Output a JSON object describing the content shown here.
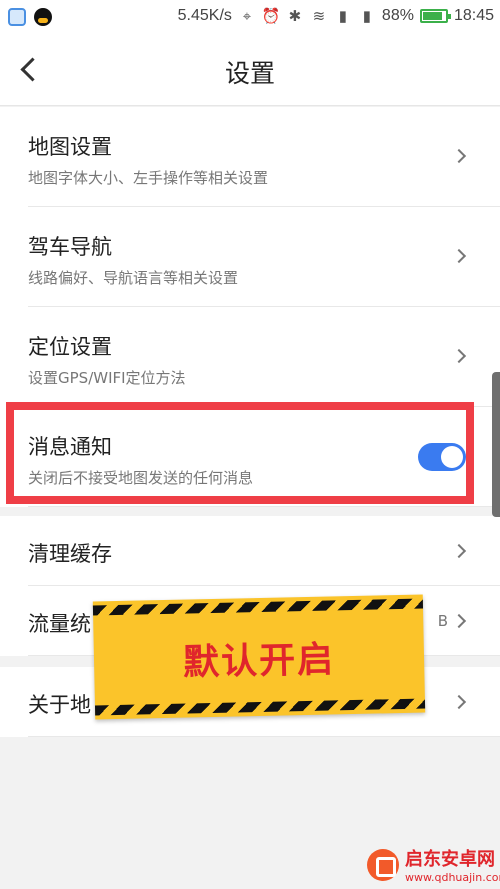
{
  "statusbar": {
    "speed": "5.45K/s",
    "battery": "88%",
    "battery_level": 0.88,
    "time": "18:45"
  },
  "header": {
    "title": "设置"
  },
  "settings": [
    {
      "title": "地图设置",
      "subtitle": "地图字体大小、左手操作等相关设置"
    },
    {
      "title": "驾车导航",
      "subtitle": "线路偏好、导航语言等相关设置"
    },
    {
      "title": "定位设置",
      "subtitle": "设置GPS/WIFI定位方法"
    },
    {
      "title": "消息通知",
      "subtitle": "关闭后不接受地图发送的任何消息",
      "toggle_on": true
    }
  ],
  "settings2": [
    {
      "title": "清理缓存"
    },
    {
      "title": "流量统",
      "right_text": "B"
    }
  ],
  "settings3": [
    {
      "title": "关于地"
    }
  ],
  "sticker": {
    "text": "默认开启"
  },
  "watermark": {
    "title": "启东安卓网",
    "url": "www.qdhuajin.com"
  }
}
